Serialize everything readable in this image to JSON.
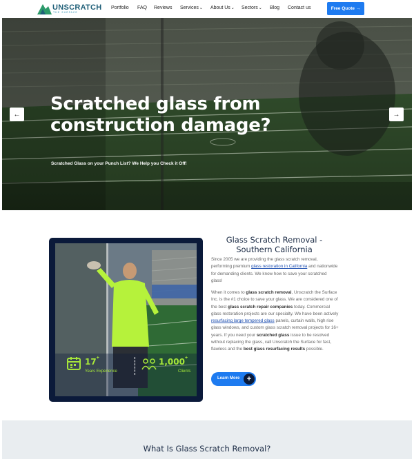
{
  "header": {
    "logo_text": "UNSCRATCH",
    "logo_sub": "THE SURFACE",
    "nav": [
      {
        "label": "Portfolio",
        "dropdown": false
      },
      {
        "label": "FAQ",
        "dropdown": false
      },
      {
        "label": "Reviews",
        "dropdown": false
      },
      {
        "label": "Services",
        "dropdown": true
      },
      {
        "label": "About Us",
        "dropdown": true
      },
      {
        "label": "Sectors",
        "dropdown": true
      },
      {
        "label": "Blog",
        "dropdown": false
      },
      {
        "label": "Contact us",
        "dropdown": false
      }
    ],
    "cta": "Free Quote →"
  },
  "hero": {
    "title": "Scratched glass from construction damage?",
    "subtitle": "Scratched Glass on your Punch List? We Help you Check it Off!",
    "prev_icon": "←",
    "next_icon": "→"
  },
  "feature": {
    "stats": [
      {
        "value": "17",
        "suffix": "+",
        "label": "Years Experience"
      },
      {
        "value": "1,000",
        "suffix": "+",
        "label": "Clients"
      }
    ],
    "title": "Glass Scratch Removal - Southern California",
    "para1_a": "Since 2005 we are providing the glass scratch removal, performing premium ",
    "para1_link": "glass restoration in California",
    "para1_b": " and nationwide for demanding clients. We know how to save your scratched glass!",
    "para2_a": "When it comes to ",
    "para2_b1": "glass scratch removal",
    "para2_c": ", Unscratch the Surface Inc. is the #1 choice to save your glass. We are considered one of the best ",
    "para2_b2": "glass scratch repair companies",
    "para2_d": " today. Commercial glass restoration projects are our specialty. We have been actively ",
    "para2_link": "resurfacing large tempered glass",
    "para2_e": " panels, curtain walls, high rise glass windows, and custom glass scratch removal projects for 16+ years. If you need your ",
    "para2_b3": "scratched glass",
    "para2_f": "  issue to be resolved without replacing the glass, call Unscratch the Surface for fast, flawless and the ",
    "para2_b4": "best glass resurfacing results",
    "para2_g": " possible.",
    "button": "Learn More",
    "button_icon": "+"
  },
  "bottom": {
    "title": "What Is Glass Scratch Removal?"
  },
  "colors": {
    "accent": "#1e7bf0",
    "navy": "#0b1a3a",
    "stat_green": "#a6e63a",
    "section_bg": "#e9edf0"
  }
}
